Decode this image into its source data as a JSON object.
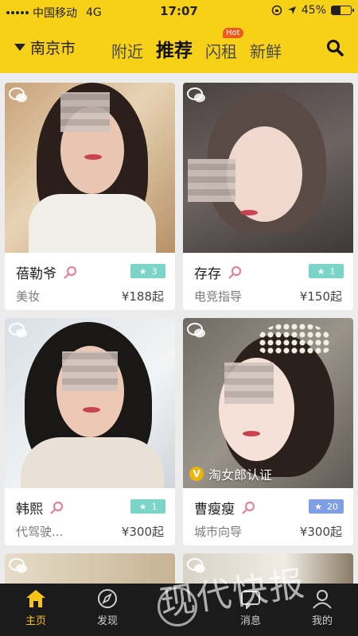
{
  "status": {
    "carrier": "中国移动",
    "network": "4G",
    "time": "17:07",
    "battery": "45%",
    "battery_level": 0.45
  },
  "header": {
    "city": "南京市",
    "tabs": [
      {
        "label": "附近",
        "active": false
      },
      {
        "label": "推荐",
        "active": true
      },
      {
        "label": "闪租",
        "active": false,
        "badge": "Hot"
      },
      {
        "label": "新鲜",
        "active": false
      }
    ]
  },
  "cards": [
    {
      "name": "蓓勒爷",
      "level": "3",
      "service": "美妆",
      "price": "¥188起",
      "level_color": "#7ad4c8"
    },
    {
      "name": "存存",
      "level": "1",
      "service": "电竞指导",
      "price": "¥150起",
      "level_color": "#7ad4c8"
    },
    {
      "name": "韩熙",
      "level": "1",
      "service": "代驾驶...",
      "price": "¥300起",
      "level_color": "#7ad4c8"
    },
    {
      "name": "曹瘦瘦",
      "level": "20",
      "service": "城市向导",
      "price": "¥300起",
      "level_color": "#7f9ee3",
      "verified": "淘女郎认证"
    }
  ],
  "nav": [
    {
      "label": "主页",
      "icon": "home-icon",
      "active": true
    },
    {
      "label": "发现",
      "icon": "compass-icon",
      "active": false
    },
    {
      "label": "消息",
      "icon": "message-icon",
      "active": false
    },
    {
      "label": "我的",
      "icon": "profile-icon",
      "active": false
    }
  ],
  "watermark": "现代快报",
  "colors": {
    "brand_yellow": "#f7d117",
    "nav_bg": "#1b1b1b",
    "active_nav": "#f7c417",
    "female_pink": "#e87fa0"
  }
}
